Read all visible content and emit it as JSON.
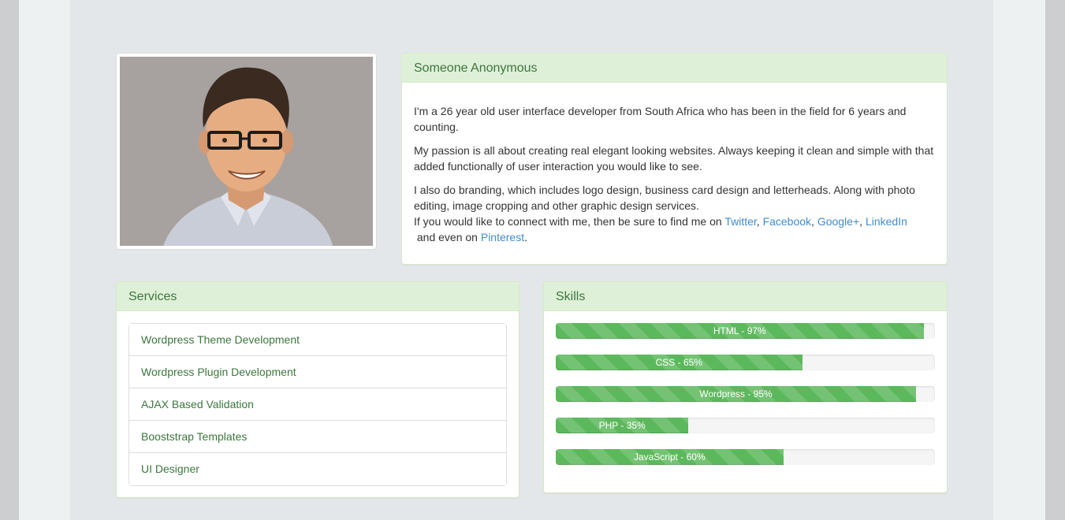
{
  "about": {
    "name": "Someone Anonymous",
    "p1": "I'm a 26 year old user interface developer from South Africa who has been in the field for 6 years and counting.",
    "p2": "My passion is all about creating real elegant looking websites. Always keeping it clean and simple with that added functionally of user interaction you would like to see.",
    "p3": "I also do branding, which includes logo design, business card design and letterheads. Along with photo editing, image cropping and other graphic design services.",
    "connect_prefix": "If you would like to connect with me, then be sure to find me on",
    "links": {
      "twitter": "Twitter",
      "facebook": "Facebook",
      "googleplus": "Google+",
      "linkedin": "LinkedIn",
      "pinterest": "Pinterest"
    },
    "sep1": ", ",
    "sep2": ", ",
    "sep3": ", ",
    "connect_mid": " and even on ",
    "connect_end": "."
  },
  "services": {
    "title": "Services",
    "items": [
      "Wordpress Theme Development",
      "Wordpress Plugin Development",
      "AJAX Based Validation",
      "Booststrap Templates",
      "UI Designer"
    ]
  },
  "skills": {
    "title": "Skills",
    "items": [
      {
        "label": "HTML - 97%",
        "percent": 97
      },
      {
        "label": "CSS - 65%",
        "percent": 65
      },
      {
        "label": "Wordpress - 95%",
        "percent": 95
      },
      {
        "label": "PHP - 35%",
        "percent": 35
      },
      {
        "label": "JavaScript - 60%",
        "percent": 60
      }
    ]
  },
  "colors": {
    "panel_heading_bg": "#dff0d8",
    "panel_heading_text": "#3c763d",
    "link": "#428bca",
    "progress_bar": "#5cb85c"
  },
  "icons": {
    "profile_photo": "avatar-illustration"
  }
}
